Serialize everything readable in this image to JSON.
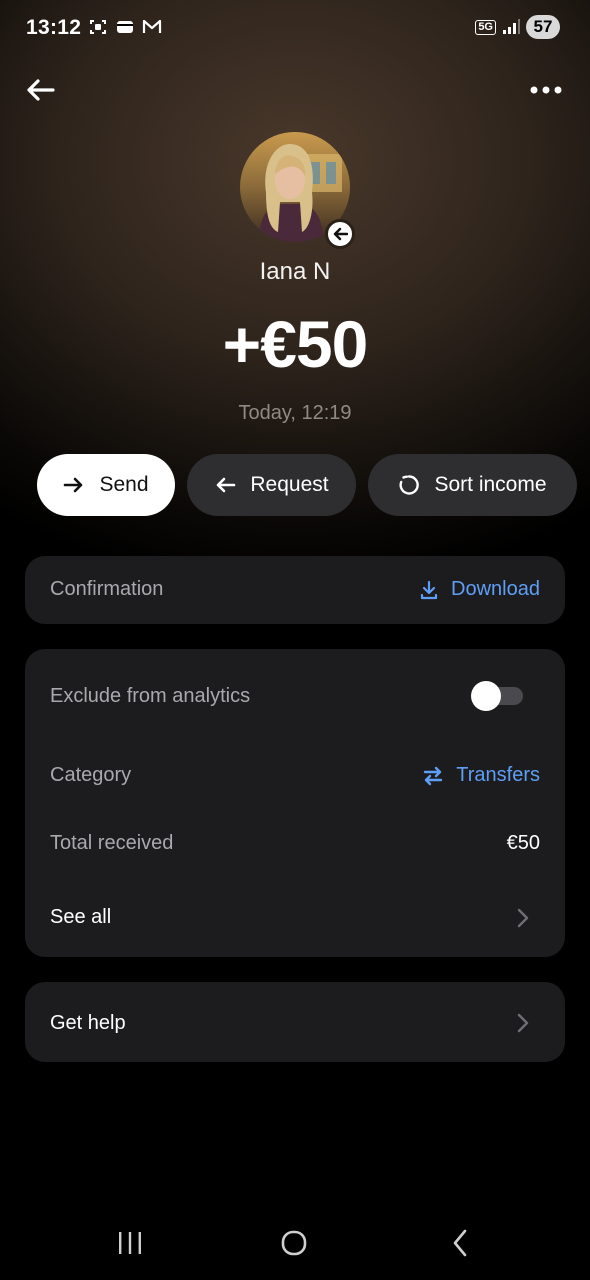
{
  "status_bar": {
    "time": "13:12",
    "network": "5G",
    "battery": "57",
    "icons": [
      "screenshot-icon",
      "wallet-icon",
      "gmail-icon",
      "signal-icon"
    ]
  },
  "top_bar": {
    "back_icon": "arrow-left-icon",
    "more_icon": "more-dots-icon"
  },
  "transaction": {
    "name": "Iana N",
    "amount": "+€50",
    "datetime": "Today, 12:19",
    "direction_icon": "incoming-arrow-icon"
  },
  "actions": {
    "send_label": "Send",
    "request_label": "Request",
    "sort_label": "Sort income"
  },
  "confirmation": {
    "label": "Confirmation",
    "download_label": "Download"
  },
  "details": {
    "exclude_label": "Exclude from analytics",
    "exclude_on": false,
    "category_label": "Category",
    "category_value": "Transfers",
    "total_label": "Total received",
    "total_value": "€50",
    "see_all_label": "See all"
  },
  "help": {
    "label": "Get help"
  },
  "colors": {
    "accent": "#5e9ef4",
    "card": "#1c1c1e",
    "pill_secondary": "#2e2e30"
  }
}
